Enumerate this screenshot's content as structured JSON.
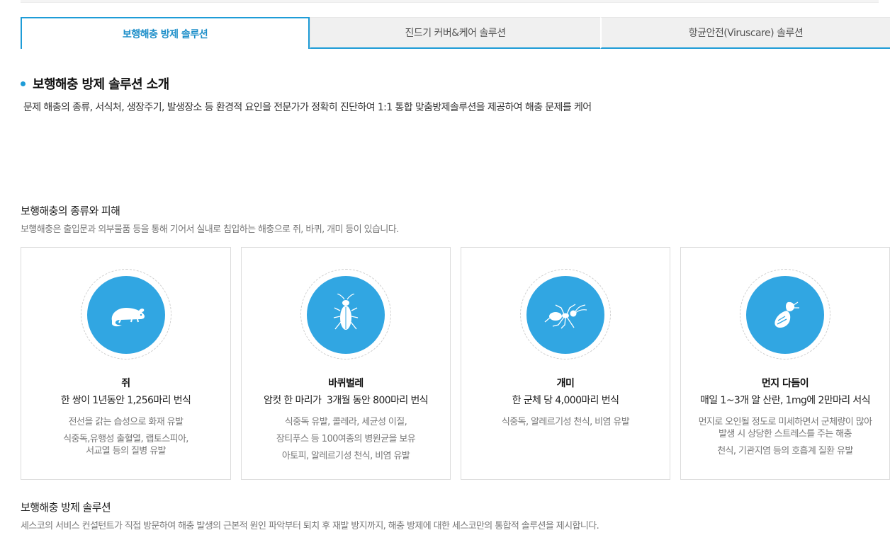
{
  "tabs": [
    {
      "label": "보행해충 방제 솔루션",
      "active": true
    },
    {
      "label": "진드기 커버&케어 솔루션",
      "active": false
    },
    {
      "label": "항균안전(Viruscare) 솔루션",
      "active": false
    }
  ],
  "intro": {
    "title": "보행해충 방제 솔루션 소개",
    "description": "문제 해충의 종류, 서식처, 생장주기, 발생장소 등 환경적 요인을 전문가가 정확히 진단하여 1:1 통합 맞춤방제솔루션을 제공하여 해충 문제를 케어"
  },
  "types_section": {
    "title": "보행해충의 종류와 피해",
    "description": "보행해충은 출입문과 외부물품 등을 통해 기어서 실내로 침입하는 해충으로 쥐, 바퀴, 개미 등이 있습니다."
  },
  "pests": [
    {
      "icon": "rat-icon",
      "name": "쥐",
      "fact": "한 쌍이 1년동안 1,256마리 번식",
      "harms": [
        "전선을 갉는 습성으로 화재 유발",
        "식중독,유행성 출혈열, 랩토스피아,\n서교열 등의 질병 유발"
      ]
    },
    {
      "icon": "cockroach-icon",
      "name": "바퀴벌레",
      "fact": "암컷 한 마리가  3개월 동안 800마리 번식",
      "harms": [
        "식중독 유발, 콜레라, 세균성 이질,",
        "장티푸스 등 100여종의 병원균을 보유",
        "아토피, 알레르기성 천식, 비염 유발"
      ]
    },
    {
      "icon": "ant-icon",
      "name": "개미",
      "fact": "한 군체 당 4,000마리 번식",
      "harms": [
        "식중독, 알레르기성 천식, 비염 유발"
      ]
    },
    {
      "icon": "dust-mite-icon",
      "name": "먼지 다듬이",
      "fact": "매일 1~3개 알 산란, 1mg에 2만마리 서식",
      "harms": [
        "먼지로 오인될 정도로 미세하면서 군체량이 많아\n발생 시 상당한 스트레스를 주는 해충",
        "천식, 기관지염 등의 호흡계 질환 유발"
      ]
    }
  ],
  "solution_section": {
    "title": "보행해충 방제 솔루션",
    "description": "세스코의 서비스 컨설턴트가 직접 방문하여 해충 발생의 근본적 원인 파악부터 퇴치 후 재발 방지까지, 해충 방제에 대한 세스코만의 통합적 솔루션을 제시합니다."
  },
  "colors": {
    "accent": "#1e9cd7",
    "icon_bg": "#31a6e2"
  }
}
